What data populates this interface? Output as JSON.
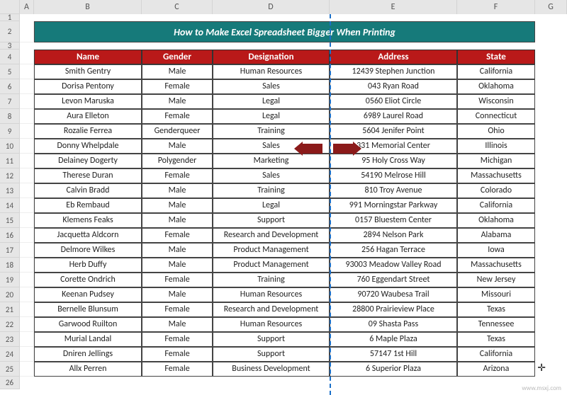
{
  "title": "How to Make Excel Spreadsheet Bigger When Printing",
  "columns": [
    "A",
    "B",
    "C",
    "D",
    "E",
    "F",
    "G"
  ],
  "headers": {
    "name": "Name",
    "gender": "Gender",
    "designation": "Designation",
    "address": "Address",
    "state": "State"
  },
  "rows": [
    {
      "name": "Smith Gentry",
      "gender": "Male",
      "designation": "Human Resources",
      "address": "12439 Stephen Junction",
      "state": "California"
    },
    {
      "name": "Dorisa Pentony",
      "gender": "Female",
      "designation": "Sales",
      "address": "043 Ryan Road",
      "state": "Oklahoma"
    },
    {
      "name": "Levon Maruska",
      "gender": "Male",
      "designation": "Legal",
      "address": "0560 Eliot Circle",
      "state": "Wisconsin"
    },
    {
      "name": "Aura Elleton",
      "gender": "Female",
      "designation": "Legal",
      "address": "6989 Laurel Road",
      "state": "Connecticut"
    },
    {
      "name": "Rozalie Ferrea",
      "gender": "Genderqueer",
      "designation": "Training",
      "address": "5604 Jenifer Point",
      "state": "Ohio"
    },
    {
      "name": "Donny Whelpdale",
      "gender": "Male",
      "designation": "Sales",
      "address": "331 Memorial Center",
      "state": "Illinois"
    },
    {
      "name": "Delainey Dogerty",
      "gender": "Polygender",
      "designation": "Marketing",
      "address": "95 Holy Cross Way",
      "state": "Michigan"
    },
    {
      "name": "Therese Duran",
      "gender": "Female",
      "designation": "Sales",
      "address": "54190 Melrose Hill",
      "state": "Massachusetts"
    },
    {
      "name": "Calvin Bradd",
      "gender": "Male",
      "designation": "Training",
      "address": "810 Troy Avenue",
      "state": "Colorado"
    },
    {
      "name": "Eb Rembaud",
      "gender": "Male",
      "designation": "Legal",
      "address": "991 Morningstar Parkway",
      "state": "California"
    },
    {
      "name": "Klemens Feaks",
      "gender": "Male",
      "designation": "Support",
      "address": "0157 Bluestem Center",
      "state": "Oklahoma"
    },
    {
      "name": "Jacquetta Aldcorn",
      "gender": "Female",
      "designation": "Research and Development",
      "address": "2894 Nelson Park",
      "state": "Alabama"
    },
    {
      "name": "Delmore Wilkes",
      "gender": "Male",
      "designation": "Product Management",
      "address": "256 Hagan Terrace",
      "state": "Iowa"
    },
    {
      "name": "Herb Duffy",
      "gender": "Male",
      "designation": "Product Management",
      "address": "93003 Meadow Valley Road",
      "state": "Massachusetts"
    },
    {
      "name": "Corette Ondrich",
      "gender": "Female",
      "designation": "Training",
      "address": "760 Eggendart Street",
      "state": "New Jersey"
    },
    {
      "name": "Keenan Pudsey",
      "gender": "Male",
      "designation": "Human Resources",
      "address": "90720 Waubesa Trail",
      "state": "Missouri"
    },
    {
      "name": "Bernelle Blunsum",
      "gender": "Female",
      "designation": "Research and Development",
      "address": "28800 Prairieview Place",
      "state": "Texas"
    },
    {
      "name": "Garwood Ruilton",
      "gender": "Male",
      "designation": "Human Resources",
      "address": "09 Shasta Pass",
      "state": "Tennessee"
    },
    {
      "name": "Murial Landal",
      "gender": "Female",
      "designation": "Support",
      "address": "6 Maple Plaza",
      "state": "Texas"
    },
    {
      "name": "Dniren Jellings",
      "gender": "Female",
      "designation": "Support",
      "address": "57147 1st Hill",
      "state": "California"
    },
    {
      "name": "Allx Perren",
      "gender": "Female",
      "designation": "Business Development",
      "address": "6 Superior Plaza",
      "state": "Arizona"
    }
  ],
  "watermark": "www.msxj.com"
}
